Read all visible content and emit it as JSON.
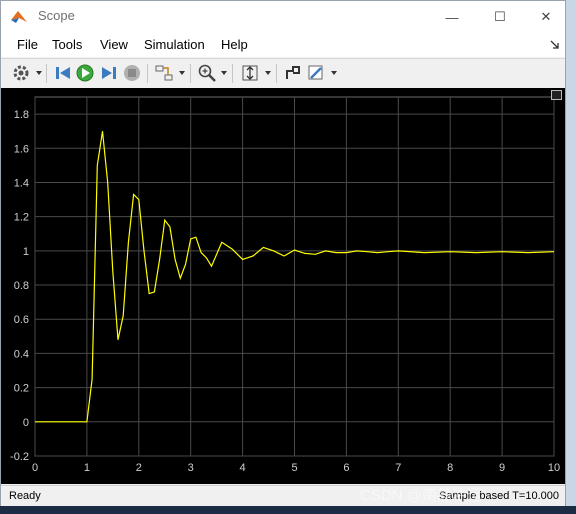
{
  "window": {
    "title": "Scope",
    "minimize_glyph": "—",
    "maximize_glyph": "☐",
    "close_glyph": "✕"
  },
  "menu": [
    "File",
    "Tools",
    "View",
    "Simulation",
    "Help"
  ],
  "toolbar": {
    "icons": [
      "gear-icon",
      "step-back-icon",
      "run-icon",
      "step-forward-icon",
      "stop-icon",
      "signal-tracing-icon",
      "zoom-icon",
      "scale-axes-icon",
      "highlight-icon",
      "edit-icon"
    ]
  },
  "status": {
    "left": "Ready",
    "right": "Sample based  T=10.000"
  },
  "watermark": "CSDN @南静冲运",
  "colors": {
    "plot_bg": "#000000",
    "grid": "#4a4a4a",
    "tick_label": "#d0d0d0",
    "line": "#ffff00"
  },
  "chart_data": {
    "type": "line",
    "xlim": [
      0,
      10
    ],
    "ylim": [
      -0.2,
      1.9
    ],
    "xticks": [
      0,
      1,
      2,
      3,
      4,
      5,
      6,
      7,
      8,
      9,
      10
    ],
    "yticks": [
      "-0.2",
      "0",
      "0.2",
      "0.4",
      "0.6",
      "0.8",
      "1",
      "1.2",
      "1.4",
      "1.6",
      "1.8"
    ],
    "grid": true,
    "series": [
      {
        "x": [
          0,
          1.0,
          1.1,
          1.2,
          1.3,
          1.4,
          1.5,
          1.6,
          1.7,
          1.8,
          1.9,
          2.0,
          2.1,
          2.2,
          2.3,
          2.4,
          2.5,
          2.6,
          2.7,
          2.8,
          2.9,
          3.0,
          3.1,
          3.2,
          3.3,
          3.4,
          3.6,
          3.8,
          4.0,
          4.2,
          4.4,
          4.6,
          4.8,
          5.0,
          5.2,
          5.4,
          5.6,
          5.8,
          6.0,
          6.2,
          6.4,
          6.6,
          6.8,
          7.0,
          7.5,
          8.0,
          8.5,
          9.0,
          9.5,
          10.0
        ],
        "y": [
          0,
          0,
          0.25,
          1.5,
          1.7,
          1.4,
          0.88,
          0.48,
          0.62,
          1.05,
          1.33,
          1.3,
          1.0,
          0.75,
          0.76,
          0.95,
          1.18,
          1.14,
          0.95,
          0.84,
          0.92,
          1.07,
          1.08,
          0.99,
          0.96,
          0.91,
          1.05,
          1.01,
          0.95,
          0.97,
          1.02,
          1.0,
          0.97,
          1.005,
          0.985,
          0.98,
          1.0,
          0.99,
          0.99,
          1.0,
          0.995,
          0.99,
          0.995,
          1.0,
          0.99,
          0.995,
          0.99,
          0.995,
          0.99,
          0.995
        ]
      }
    ]
  }
}
